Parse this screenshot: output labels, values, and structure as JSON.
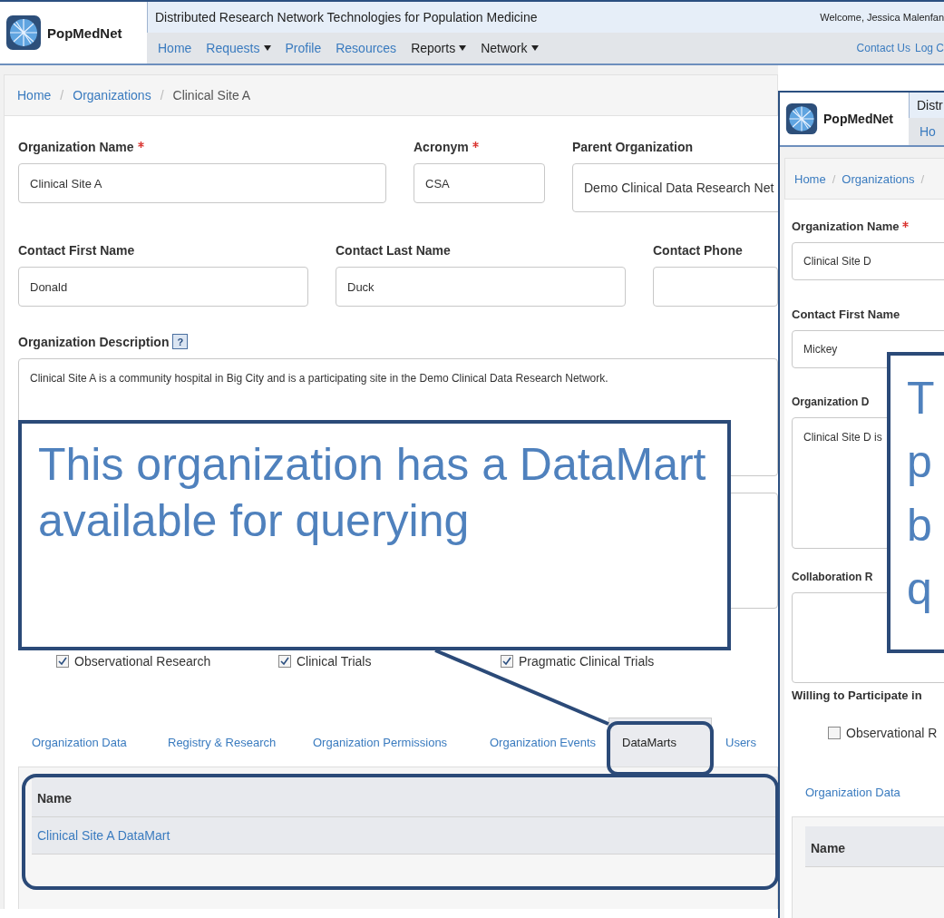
{
  "main_window": {
    "logo": "PopMedNet",
    "title": "Distributed Research Network Technologies for Population Medicine",
    "welcome": "Welcome, Jessica Malenfan",
    "nav": [
      {
        "label": "Home",
        "kind": "link",
        "caret": false
      },
      {
        "label": "Requests",
        "kind": "link",
        "caret": true
      },
      {
        "label": "Profile",
        "kind": "link",
        "caret": false
      },
      {
        "label": "Resources",
        "kind": "link",
        "caret": false
      },
      {
        "label": "Reports",
        "kind": "menu",
        "caret": true
      },
      {
        "label": "Network",
        "kind": "menu",
        "caret": true
      }
    ],
    "top_links": [
      "Contact Us",
      "Log C"
    ],
    "breadcrumb": [
      {
        "kind": "link",
        "text": "Home"
      },
      {
        "kind": "separator",
        "text": "/"
      },
      {
        "kind": "link",
        "text": "Organizations"
      },
      {
        "kind": "separator",
        "text": "/"
      },
      {
        "kind": "current",
        "text": "Clinical Site A"
      }
    ],
    "field_rows": [
      [
        {
          "label": "Organization Name",
          "required": true,
          "value": "Clinical Site A"
        },
        {
          "label": "Acronym",
          "required": true,
          "value": "CSA"
        },
        {
          "label": "Parent Organization",
          "required": false,
          "value": "Demo Clinical Data Research Net",
          "kind": "select"
        }
      ],
      [
        {
          "label": "Contact First Name",
          "required": false,
          "value": "Donald"
        },
        {
          "label": "Contact Last Name",
          "required": false,
          "value": "Duck"
        },
        {
          "label": "Contact Phone",
          "required": false
        }
      ]
    ],
    "description": {
      "label": "Organization Description",
      "help": "?",
      "value": "Clinical Site A is a community hospital in Big City and is a participating site in the Demo Clinical Data Research Network."
    },
    "participation": [
      {
        "label": "Observational Research",
        "checked": true
      },
      {
        "label": "Clinical Trials",
        "checked": true
      },
      {
        "label": "Pragmatic Clinical Trials",
        "checked": true
      }
    ],
    "tabs": [
      {
        "label": "Organization Data",
        "selected": false
      },
      {
        "label": "Registry & Research",
        "selected": false
      },
      {
        "label": "Organization Permissions",
        "selected": false
      },
      {
        "label": "Organization Events",
        "selected": false
      },
      {
        "label": "DataMarts",
        "selected": true
      },
      {
        "label": "Users",
        "selected": false
      }
    ],
    "table": {
      "columns": [
        "Name"
      ],
      "rows": [
        [
          "Clinical Site A DataMart"
        ]
      ]
    }
  },
  "second_window": {
    "logo": "PopMedNet",
    "title": "Distr",
    "nav": [
      "Ho"
    ],
    "breadcrumb": [
      {
        "kind": "link",
        "text": "Home"
      },
      {
        "kind": "separator",
        "text": "/"
      },
      {
        "kind": "link",
        "text": "Organizations"
      },
      {
        "kind": "separator",
        "text": "/"
      }
    ],
    "fields": [
      {
        "label": "Organization Name",
        "required": true,
        "value": "Clinical Site D"
      },
      {
        "label": "Contact First Name",
        "required": false,
        "value": "Mickey"
      }
    ],
    "description": {
      "label": "Organization D",
      "value": "Clinical Site D is"
    },
    "collaboration": {
      "label": "Collaboration R"
    },
    "participation_label": "Willing to Participate in",
    "participation": [
      {
        "label": "Observational R",
        "checked": false
      }
    ],
    "tabs": [
      {
        "label": "Organization Data",
        "selected": false
      }
    ],
    "table": {
      "columns": [
        "Name"
      ]
    }
  },
  "callouts": [
    {
      "text": "This organization has a DataMart available for querying"
    },
    {
      "lines": [
        "T",
        "p",
        "b",
        "q"
      ]
    }
  ]
}
